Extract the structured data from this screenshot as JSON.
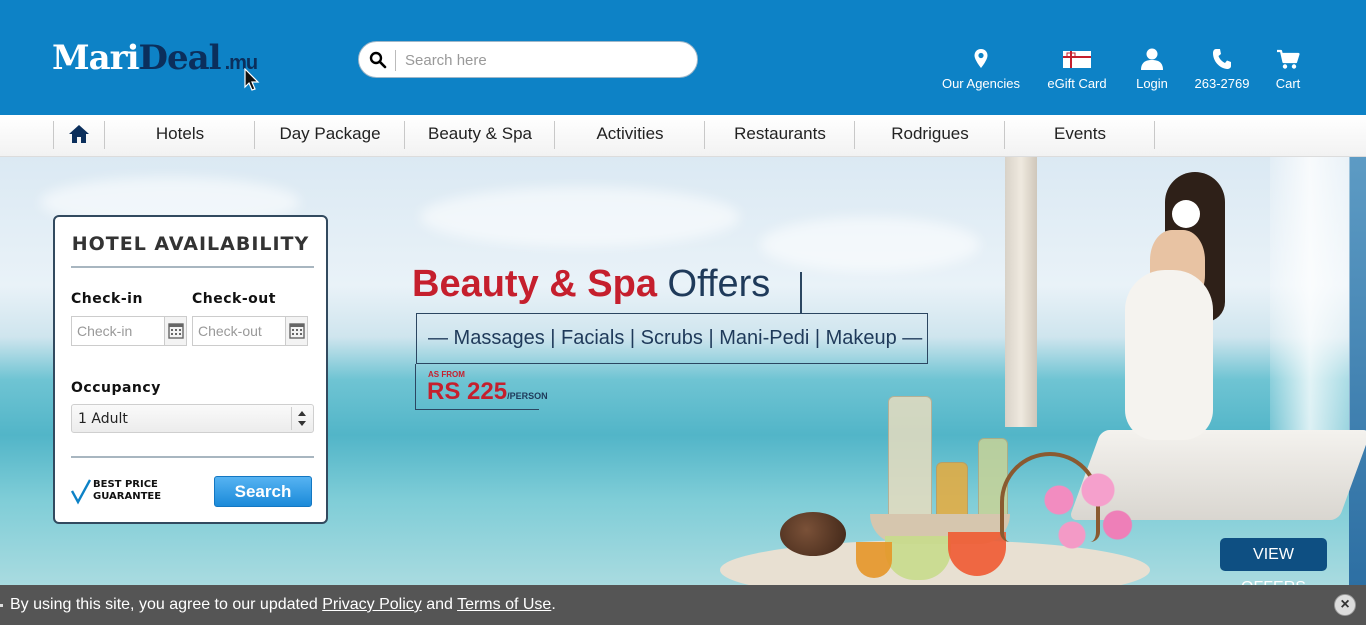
{
  "header": {
    "logo": {
      "mari": "Mari",
      "deal": "Deal",
      "mu": ".mu"
    },
    "search": {
      "placeholder": "Search here"
    },
    "items": [
      {
        "label": "Our Agencies",
        "icon": "map-pin-icon"
      },
      {
        "label": "eGift Card",
        "icon": "gift-card-icon"
      },
      {
        "label": "Login",
        "icon": "user-icon"
      },
      {
        "label": "263-2769",
        "icon": "phone-icon"
      },
      {
        "label": "Cart",
        "icon": "cart-icon"
      }
    ]
  },
  "nav": {
    "home_icon": "home-icon",
    "items": [
      "Hotels",
      "Day Package",
      "Beauty & Spa",
      "Activities",
      "Restaurants",
      "Rodrigues",
      "Events"
    ]
  },
  "hero": {
    "title_red": "Beauty & Spa",
    "title_dark": "Offers",
    "services": "—  Massages | Facials | Scrubs | Mani-Pedi | Makeup  —",
    "as_from": "AS FROM",
    "price": "RS 225",
    "per": "/PERSON",
    "cta": "VIEW OFFERS"
  },
  "availability": {
    "title": "HOTEL AVAILABILITY",
    "checkin_label": "Check-in",
    "checkout_label": "Check-out",
    "checkin_placeholder": "Check-in",
    "checkout_placeholder": "Check-out",
    "occupancy_label": "Occupancy",
    "occupancy_value": "1 Adult",
    "guarantee_line1": "BEST PRICE",
    "guarantee_line2": "GUARANTEE",
    "search_label": "Search"
  },
  "cookie": {
    "prefix": "By using this site, you agree to our updated ",
    "privacy": "Privacy Policy",
    "and": " and ",
    "terms": "Terms of Use",
    "suffix": ".",
    "close": "×"
  },
  "colors": {
    "header_bg": "#0d82c6",
    "accent_red": "#c51f2d",
    "navy": "#1f3a5a",
    "search_button": "#1b8ad9",
    "cookie_bg": "#555555"
  }
}
